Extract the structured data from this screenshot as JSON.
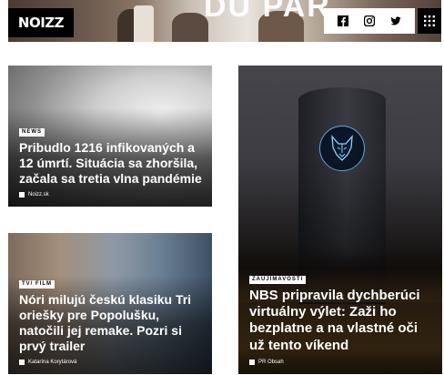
{
  "header": {
    "logo_text": "NOIZZ",
    "banner_text": "DU PAR",
    "social": [
      "facebook-icon",
      "instagram-icon",
      "twitter-icon"
    ],
    "menu_icon": "grid-menu-icon"
  },
  "cards": [
    {
      "badge": "NEWS",
      "headline": "Pribudlo 1216 infikovaných a 12 úmrtí. Situácia sa zhoršila, začala sa tretia vlna pandémie",
      "author": "Noizz.sk"
    },
    {
      "badge": "TV/ FILM",
      "headline": "Nóri milujú českú klasiku Tri oriešky pre Popolušku, natočili jej remake. Pozri si prvý trailer",
      "author": "Katarína Korytárová"
    },
    {
      "badge": "ZAUJÍMAVOSTI",
      "headline": "NBS pripravila dychberúci virtuálny výlet: Zaži ho bezplatne a na vlastné oči už tento víkend",
      "author": "PR Obsah"
    }
  ],
  "colors": {
    "logo_bg": "#000000",
    "badge_bg": "#ffffff",
    "headline": "#ffffff"
  }
}
